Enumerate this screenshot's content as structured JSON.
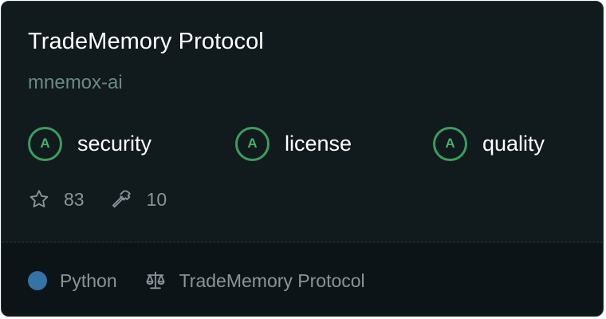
{
  "card": {
    "title": "TradeMemory Protocol",
    "owner": "mnemox-ai"
  },
  "grades": [
    {
      "grade": "A",
      "label": "security"
    },
    {
      "grade": "A",
      "label": "license"
    },
    {
      "grade": "A",
      "label": "quality"
    }
  ],
  "stats": {
    "stars": "83",
    "tools": "10"
  },
  "footer": {
    "language": "Python",
    "license": "TradeMemory Protocol"
  },
  "colors": {
    "background": "#111a1d",
    "grade_accent": "#3a9d5d",
    "language_dot": "#3572a5"
  },
  "icons": {
    "stars": "star-icon",
    "tools": "hammer-icon",
    "license": "scale-icon"
  }
}
